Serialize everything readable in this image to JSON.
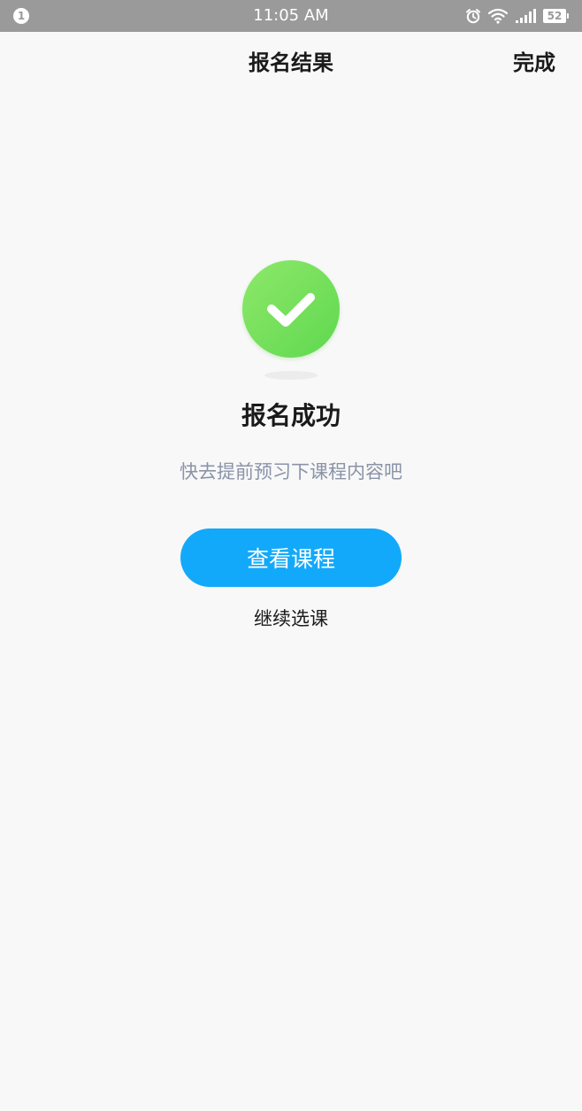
{
  "status_bar": {
    "notification_count": "1",
    "time": "11:05 AM",
    "battery_level": "52",
    "icons": [
      "alarm-icon",
      "wifi-icon",
      "signal-icon",
      "battery-icon"
    ]
  },
  "nav": {
    "title": "报名结果",
    "done_label": "完成"
  },
  "result": {
    "icon": "check-circle-icon",
    "title": "报名成功",
    "subtitle": "快去提前预习下课程内容吧"
  },
  "actions": {
    "primary_label": "查看课程",
    "secondary_label": "继续选课"
  },
  "colors": {
    "accent": "#13a9fa",
    "success": "#62d953",
    "subtitle_text": "#8a93a8",
    "status_bar_bg": "#9a9a9a",
    "page_bg": "#f8f8f8"
  }
}
